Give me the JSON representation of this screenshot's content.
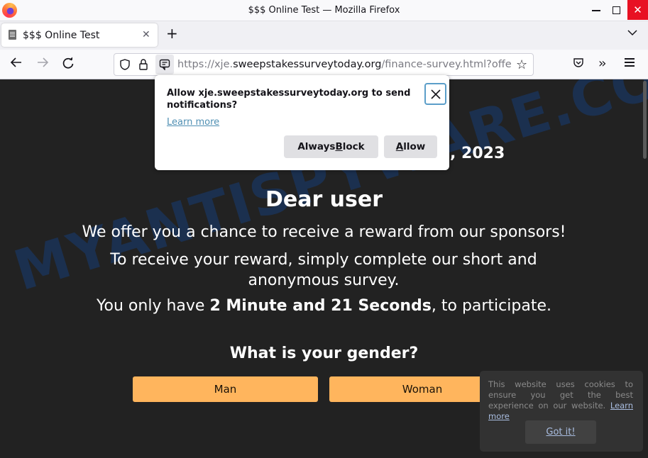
{
  "window": {
    "title": "$$$ Online Test — Mozilla Firefox",
    "controls": {
      "minimize": "minimize-icon",
      "maximize": "maximize-icon",
      "close": "close-icon"
    }
  },
  "tabs": [
    {
      "label": "$$$ Online Test",
      "icon": "page-icon",
      "active": true
    }
  ],
  "tabstrip": {
    "new_tab_icon": "plus-icon",
    "list_all_tabs_icon": "chevron-down-icon"
  },
  "navbar": {
    "back_icon": "arrow-left-icon",
    "forward_icon": "arrow-right-icon",
    "reload_icon": "reload-icon",
    "url": {
      "prefix": "https://xje.",
      "host": "sweepstakessurveytoday.org",
      "path": "/finance-survey.html?offer"
    },
    "icons": [
      "shield-icon",
      "lock-icon",
      "notification-permission-icon",
      "bookmark-star-icon",
      "pocket-icon",
      "overflow-chevrons-icon",
      "hamburger-menu-icon"
    ]
  },
  "notification_prompt": {
    "title": "Allow xje.sweepstakessurveytoday.org to send notifications?",
    "learn_more": "Learn more",
    "block_button": {
      "before": "Always ",
      "accesskey": "B",
      "after": "lock"
    },
    "allow_button": {
      "before": "",
      "accesskey": "A",
      "after": "llow"
    }
  },
  "page": {
    "watermark": "MYANTISPYWARE.COM",
    "date_fragment": ", 2023",
    "greeting": "Dear user",
    "offer_line": "We offer you a chance to receive a reward from our sponsors!",
    "survey_line": "To receive your reward, simply complete our short and anonymous survey.",
    "timer_prefix": "You only have ",
    "timer_value": "2 Minute and 21 Seconds",
    "timer_suffix": ", to participate.",
    "question": "What is your gender?",
    "answers": [
      "Man",
      "Woman"
    ],
    "accent_color": "#ffb55d",
    "background_color": "#222222"
  },
  "cookie_banner": {
    "text": "This website uses cookies to ensure you get the best experience on our website.",
    "learn_more": "Learn more",
    "button": "Got it!"
  }
}
